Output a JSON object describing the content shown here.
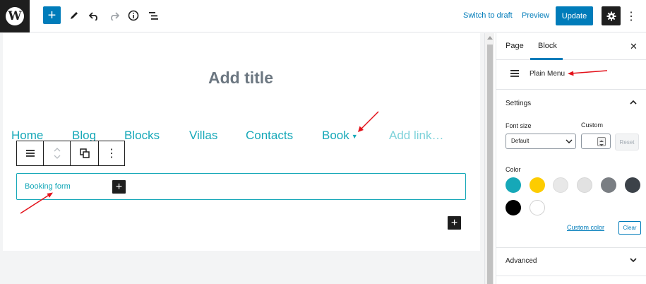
{
  "topbar": {
    "logo_letter": "W",
    "switch_to_draft": "Switch to draft",
    "preview": "Preview",
    "update": "Update"
  },
  "editor": {
    "title_placeholder": "Add title",
    "nav_items": [
      "Home",
      "Blog",
      "Blocks",
      "Villas",
      "Contacts",
      "Book"
    ],
    "nav_add_link": "Add link…",
    "booking_label": "Booking form"
  },
  "sidebar": {
    "tabs": [
      "Page",
      "Block"
    ],
    "active_tab": "Block",
    "block_name": "Plain Menu",
    "settings_title": "Settings",
    "font_size_label": "Font size",
    "custom_label": "Custom",
    "font_size_value": "Default",
    "reset_label": "Reset",
    "color_label": "Color",
    "custom_color_link": "Custom color",
    "clear_label": "Clear",
    "advanced_title": "Advanced",
    "swatches": [
      "#16a8b8",
      "#fdcc00",
      "#e8e8e8",
      "#e2e2e2",
      "#7a7e83",
      "#3c4249",
      "#000000",
      "#ffffff"
    ]
  },
  "colors": {
    "accent": "#007cba",
    "theme_teal": "#16a8b8",
    "annotation_red": "#e3111a"
  }
}
